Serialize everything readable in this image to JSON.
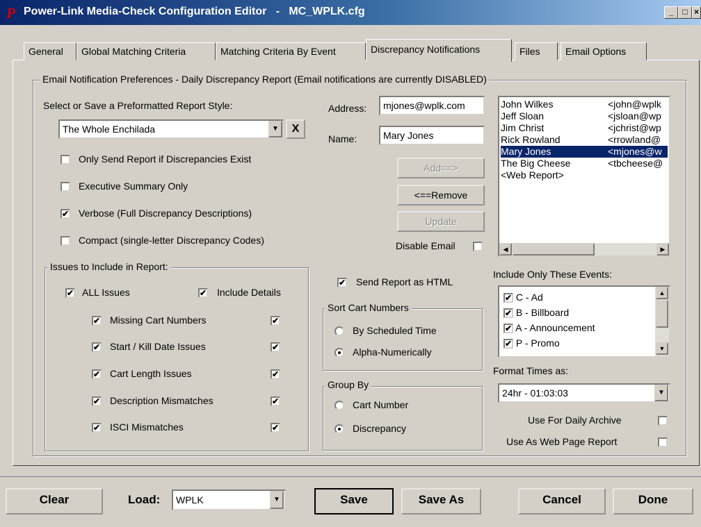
{
  "window": {
    "title": "Power-Link Media-Check Configuration Editor   -   MC_WPLK.cfg",
    "logo_text": "P"
  },
  "tabs": [
    {
      "label": "General"
    },
    {
      "label": "Global Matching Criteria"
    },
    {
      "label": "Matching Criteria By Event"
    },
    {
      "label": "Discrepancy Notifications"
    },
    {
      "label": "Files"
    },
    {
      "label": "Email Options"
    }
  ],
  "email_group": {
    "title": "Email Notification Preferences - Daily Discrepancy Report (Email notifications are currently DISABLED)"
  },
  "report_style": {
    "label": "Select or Save a Preformatted Report Style:",
    "value": "The Whole Enchilada",
    "clear_glyph": "X"
  },
  "options": [
    {
      "label": "Only Send Report if Discrepancies Exist",
      "checked": false
    },
    {
      "label": "Executive Summary Only",
      "checked": false
    },
    {
      "label": "Verbose (Full Discrepancy Descriptions)",
      "checked": true
    },
    {
      "label": "Compact (single-letter Discrepancy Codes)",
      "checked": false
    }
  ],
  "recipient": {
    "address_label": "Address:",
    "address_value": "mjones@wplk.com",
    "name_label": "Name:",
    "name_value": "Mary Jones",
    "add_label": "Add==>",
    "remove_label": "<==Remove",
    "update_label": "Update",
    "disable_label": "Disable Email"
  },
  "contacts": [
    {
      "name": "John Wilkes",
      "email": "<john@wplk",
      "selected": false
    },
    {
      "name": "Jeff Sloan",
      "email": "<jsloan@wp",
      "selected": false
    },
    {
      "name": "Jim Christ",
      "email": "<jchrist@wp",
      "selected": false
    },
    {
      "name": "Rick Rowland",
      "email": "<rrowland@",
      "selected": false
    },
    {
      "name": "Mary Jones",
      "email": "<mjones@w",
      "selected": true
    },
    {
      "name": "The Big Cheese",
      "email": "<tbcheese@",
      "selected": false
    },
    {
      "name": "<Web Report>",
      "email": "",
      "selected": false
    }
  ],
  "issues": {
    "title": "Issues to Include in Report:",
    "all_label": "ALL Issues",
    "details_label": "Include Details",
    "items": [
      {
        "label": "Missing Cart Numbers",
        "checked": true,
        "details": true
      },
      {
        "label": "Start / Kill Date Issues",
        "checked": true,
        "details": true
      },
      {
        "label": "Cart Length Issues",
        "checked": true,
        "details": true
      },
      {
        "label": "Description Mismatches",
        "checked": true,
        "details": true
      },
      {
        "label": "ISCI Mismatches",
        "checked": true,
        "details": true
      }
    ]
  },
  "send_html": {
    "label": "Send Report as HTML",
    "checked": true
  },
  "sort": {
    "title": "Sort Cart Numbers",
    "opt1": "By Scheduled Time",
    "opt2": "Alpha-Numerically",
    "selected": 2
  },
  "group_by": {
    "title": "Group By",
    "opt1": "Cart Number",
    "opt2": "Discrepancy",
    "selected": 2
  },
  "events": {
    "label": "Include Only These Events:",
    "items": [
      {
        "label": "C - Ad",
        "checked": true
      },
      {
        "label": "B - Billboard",
        "checked": true
      },
      {
        "label": "A - Announcement",
        "checked": true
      },
      {
        "label": "P - Promo",
        "checked": true
      }
    ]
  },
  "format_times": {
    "label": "Format Times as:",
    "value": "24hr - 01:03:03"
  },
  "daily_archive": {
    "label": "Use For Daily Archive",
    "checked": false
  },
  "web_report": {
    "label": "Use As Web Page Report",
    "checked": false
  },
  "bottom": {
    "clear": "Clear",
    "load_label": "Load:",
    "load_value": "WPLK",
    "save": "Save",
    "save_as": "Save As",
    "cancel": "Cancel",
    "done": "Done"
  },
  "glyphs": {
    "check": "✔",
    "arrow_down": "▼",
    "arrow_up": "▲",
    "arrow_left": "◀",
    "arrow_right": "▶",
    "min": "_",
    "max": "□",
    "close": "×"
  },
  "colors": {
    "titlebar": "#0a246a",
    "face": "#d4d0c8",
    "selection": "#0a246a"
  }
}
